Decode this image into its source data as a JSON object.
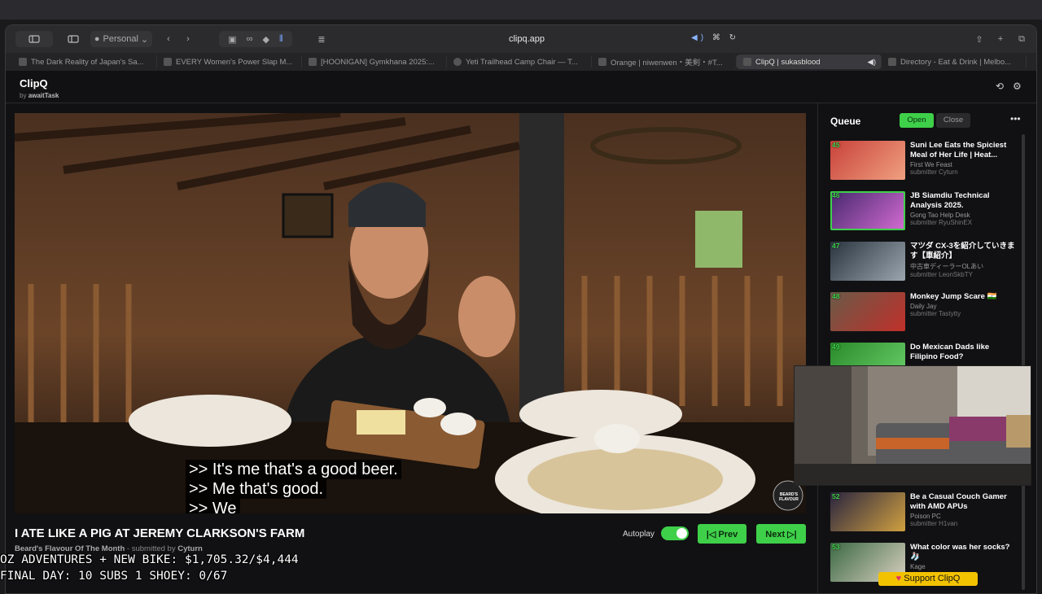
{
  "menubar": {
    "apple_icon": "apple-icon"
  },
  "browser": {
    "profile": "Personal",
    "url": "clipq.app",
    "tabs": [
      {
        "label": "The Dark Reality of Japan's Sa..."
      },
      {
        "label": "EVERY Women's Power Slap M..."
      },
      {
        "label": "[HOONIGAN] Gymkhana 2025:..."
      },
      {
        "label": "Yeti Trailhead Camp Chair — T..."
      },
      {
        "label": "Orange | niwenwen・美剣・#T..."
      },
      {
        "label": "ClipQ | sukasblood",
        "active": true
      },
      {
        "label": "Directory - Eat & Drink | Melbo..."
      }
    ]
  },
  "app": {
    "name": "ClipQ",
    "by_prefix": "by",
    "by_author": "awaitTask"
  },
  "video": {
    "captions": [
      ">> It's me that's a good beer.",
      ">> Me that's good.",
      ">> We"
    ],
    "title": "I ATE LIKE A PIG AT JEREMY CLARKSON'S FARM",
    "channel": "Beard's Flavour Of The Month",
    "submitted_prefix": "- submitted by",
    "submitter": "Cyturn",
    "watermark": "BEARD'S FLAVOUR"
  },
  "controls": {
    "autoplay_label": "Autoplay",
    "autoplay_on": true,
    "prev_label": "|◁ Prev",
    "next_label": "Next ▷|"
  },
  "queue": {
    "title": "Queue",
    "open_label": "Open",
    "close_label": "Close",
    "items": [
      {
        "num": "45",
        "title": "Suni Lee Eats the Spiciest Meal of Her Life | Heat...",
        "channel": "First We Feast",
        "submitter": "submitter Cyturn",
        "color": "#b8423a"
      },
      {
        "num": "46",
        "title": "JB Siamdiu Technical Analysis 2025.",
        "channel": "Gong Tao Help Desk",
        "submitter": "submitter RyuShinEX",
        "color": "#7a3fa0"
      },
      {
        "num": "47",
        "title": "マツダ CX-3を紹介していきます【車紹介】",
        "channel": "中古車ディーラーOLあい",
        "submitter": "submitter LeonSkbTY",
        "color": "#4a5563"
      },
      {
        "num": "48",
        "title": "Monkey Jump Scare 🇮🇳",
        "channel": "Daily Jay",
        "submitter": "submitter Tastytty",
        "color": "#6a5a48"
      },
      {
        "num": "49",
        "title": "Do Mexican Dads like Filipino Food?",
        "channel": "",
        "submitter": "",
        "color": "#3ea33a"
      },
      {
        "num": "52",
        "title": "Be a Casual Couch Gamer with AMD APUs",
        "channel": "Poison PC",
        "submitter": "submitter H1van",
        "color": "#3a3550"
      },
      {
        "num": "53",
        "title": "What color was her socks? 🧦",
        "channel": "Kage",
        "submitter": "",
        "color": "#3d6a45"
      }
    ]
  },
  "stream_overlay": {
    "line1": "OZ ADVENTURES + NEW BIKE: $1,705.32/$4,444",
    "line2": "FINAL DAY: 10 SUBS 1 SHOEY: 0/67",
    "support_label": "Support ClipQ"
  },
  "colors": {
    "accent": "#3fd04a",
    "support": "#f2c200"
  }
}
